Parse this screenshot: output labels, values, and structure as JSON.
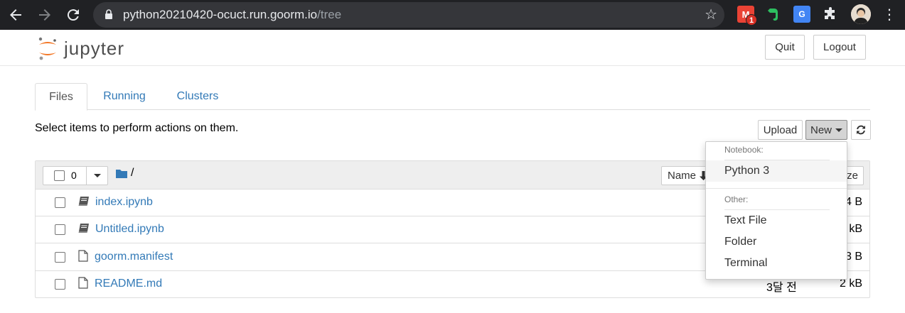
{
  "browser": {
    "url_host": "python20210420-ocuct.run.goorm.io",
    "url_path": "/tree",
    "gmail_badge": "1",
    "translate_label": "G"
  },
  "header": {
    "logo_text": "jupyter",
    "quit_label": "Quit",
    "logout_label": "Logout"
  },
  "tabs": [
    {
      "label": "Files",
      "active": true
    },
    {
      "label": "Running",
      "active": false
    },
    {
      "label": "Clusters",
      "active": false
    }
  ],
  "toolbar": {
    "select_message": "Select items to perform actions on them.",
    "upload_label": "Upload",
    "new_label": "New"
  },
  "list": {
    "selected_count": "0",
    "breadcrumb": "/",
    "sort_label": "Name",
    "size_header_visible": "ze",
    "rows": [
      {
        "name": "index.ipynb",
        "type": "notebook",
        "modified": "",
        "size": "4 B"
      },
      {
        "name": "Untitled.ipynb",
        "type": "notebook",
        "modified": "",
        "size": "kB"
      },
      {
        "name": "goorm.manifest",
        "type": "file",
        "modified": "",
        "size": "3 B"
      },
      {
        "name": "README.md",
        "type": "file",
        "modified": "3달 전",
        "size": "2 kB"
      }
    ]
  },
  "new_menu": {
    "notebook_header": "Notebook:",
    "notebook_items": [
      "Python 3"
    ],
    "other_header": "Other:",
    "other_items": [
      "Text File",
      "Folder",
      "Terminal"
    ]
  },
  "colors": {
    "link": "#337ab7",
    "logo_orange": "#f37726",
    "browser_bg": "#202124"
  }
}
